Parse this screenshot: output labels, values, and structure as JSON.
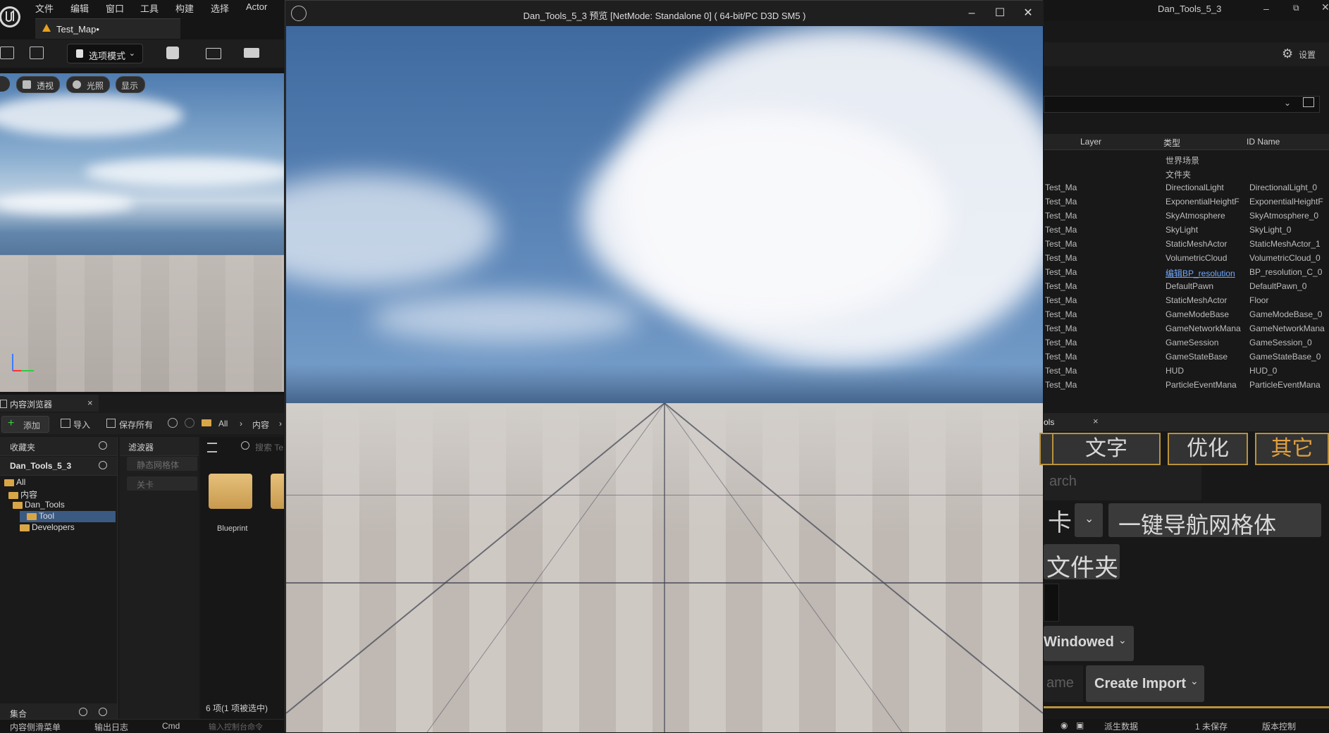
{
  "editor": {
    "menu": [
      "文件",
      "编辑",
      "窗口",
      "工具",
      "构建",
      "选择",
      "Actor"
    ],
    "map_tab": "Test_Map•",
    "mode_button": "选项模式",
    "viewport_pills": [
      "透视",
      "光照",
      "显示"
    ]
  },
  "content_browser": {
    "tab": "内容浏览器",
    "toolbar": {
      "add": "添加",
      "import": "导入",
      "save_all": "保存所有",
      "path_all": "All",
      "path_content": "内容"
    },
    "favorites": "收藏夹",
    "project": "Dan_Tools_5_3",
    "tree": [
      "All",
      "内容",
      "Dan_Tools",
      "Tool",
      "Developers"
    ],
    "filters_header": "滤波器",
    "filters": [
      "静态网格体",
      "关卡"
    ],
    "search_placeholder": "搜索 Te",
    "asset_label": "Blueprint",
    "collections": "集合",
    "item_count": "6 项(1 项被选中)",
    "status": {
      "drawer": "内容侧滑菜单",
      "output": "输出日志",
      "cmd": "Cmd",
      "console_placeholder": "输入控制台命令"
    }
  },
  "pie": {
    "title": "Dan_Tools_5_3 预览 [NetMode: Standalone 0]  ( 64-bit/PC D3D SM5 )"
  },
  "right": {
    "project": "Dan_Tools_5_3",
    "settings": "设置",
    "outliner": {
      "columns": [
        "Layer",
        "类型",
        "ID Name"
      ],
      "rows": [
        {
          "name": "",
          "type": "世界场景",
          "id": ""
        },
        {
          "name": "",
          "type": "文件夹",
          "id": ""
        },
        {
          "name": "Test_Ma",
          "type": "DirectionalLight",
          "id": "DirectionalLight_0"
        },
        {
          "name": "Test_Ma",
          "type": "ExponentialHeightF",
          "id": "ExponentialHeightF"
        },
        {
          "name": "Test_Ma",
          "type": "SkyAtmosphere",
          "id": "SkyAtmosphere_0"
        },
        {
          "name": "Test_Ma",
          "type": "SkyLight",
          "id": "SkyLight_0"
        },
        {
          "name": "Test_Ma",
          "type": "StaticMeshActor",
          "id": "StaticMeshActor_1"
        },
        {
          "name": "Test_Ma",
          "type": "VolumetricCloud",
          "id": "VolumetricCloud_0"
        },
        {
          "name": "Test_Ma",
          "type": "编辑BP_resolution",
          "id": "BP_resolution_C_0"
        },
        {
          "name": "Test_Ma",
          "type": "DefaultPawn",
          "id": "DefaultPawn_0"
        },
        {
          "name": "Test_Ma",
          "type": "StaticMeshActor",
          "id": "Floor"
        },
        {
          "name": "Test_Ma",
          "type": "GameModeBase",
          "id": "GameModeBase_0"
        },
        {
          "name": "Test_Ma",
          "type": "GameNetworkMana",
          "id": "GameNetworkMana"
        },
        {
          "name": "Test_Ma",
          "type": "GameSession",
          "id": "GameSession_0"
        },
        {
          "name": "Test_Ma",
          "type": "GameStateBase",
          "id": "GameStateBase_0"
        },
        {
          "name": "Test_Ma",
          "type": "HUD",
          "id": "HUD_0"
        },
        {
          "name": "Test_Ma",
          "type": "ParticleEventMana",
          "id": "ParticleEventMana"
        }
      ]
    },
    "tools_tab": "ols",
    "tool_tabs": [
      "文字",
      "优化",
      "其它"
    ],
    "search_placeholder": "arch",
    "nav_button": "一键导航网格体",
    "left_fragment_1": "卡",
    "folder_fragment": "文件夹",
    "windowed": "Windowed",
    "name_placeholder": "ame",
    "create_import": "Create Import",
    "bottom": {
      "derived": "派生数据",
      "unsaved": "1 未保存",
      "version": "版本控制"
    }
  }
}
